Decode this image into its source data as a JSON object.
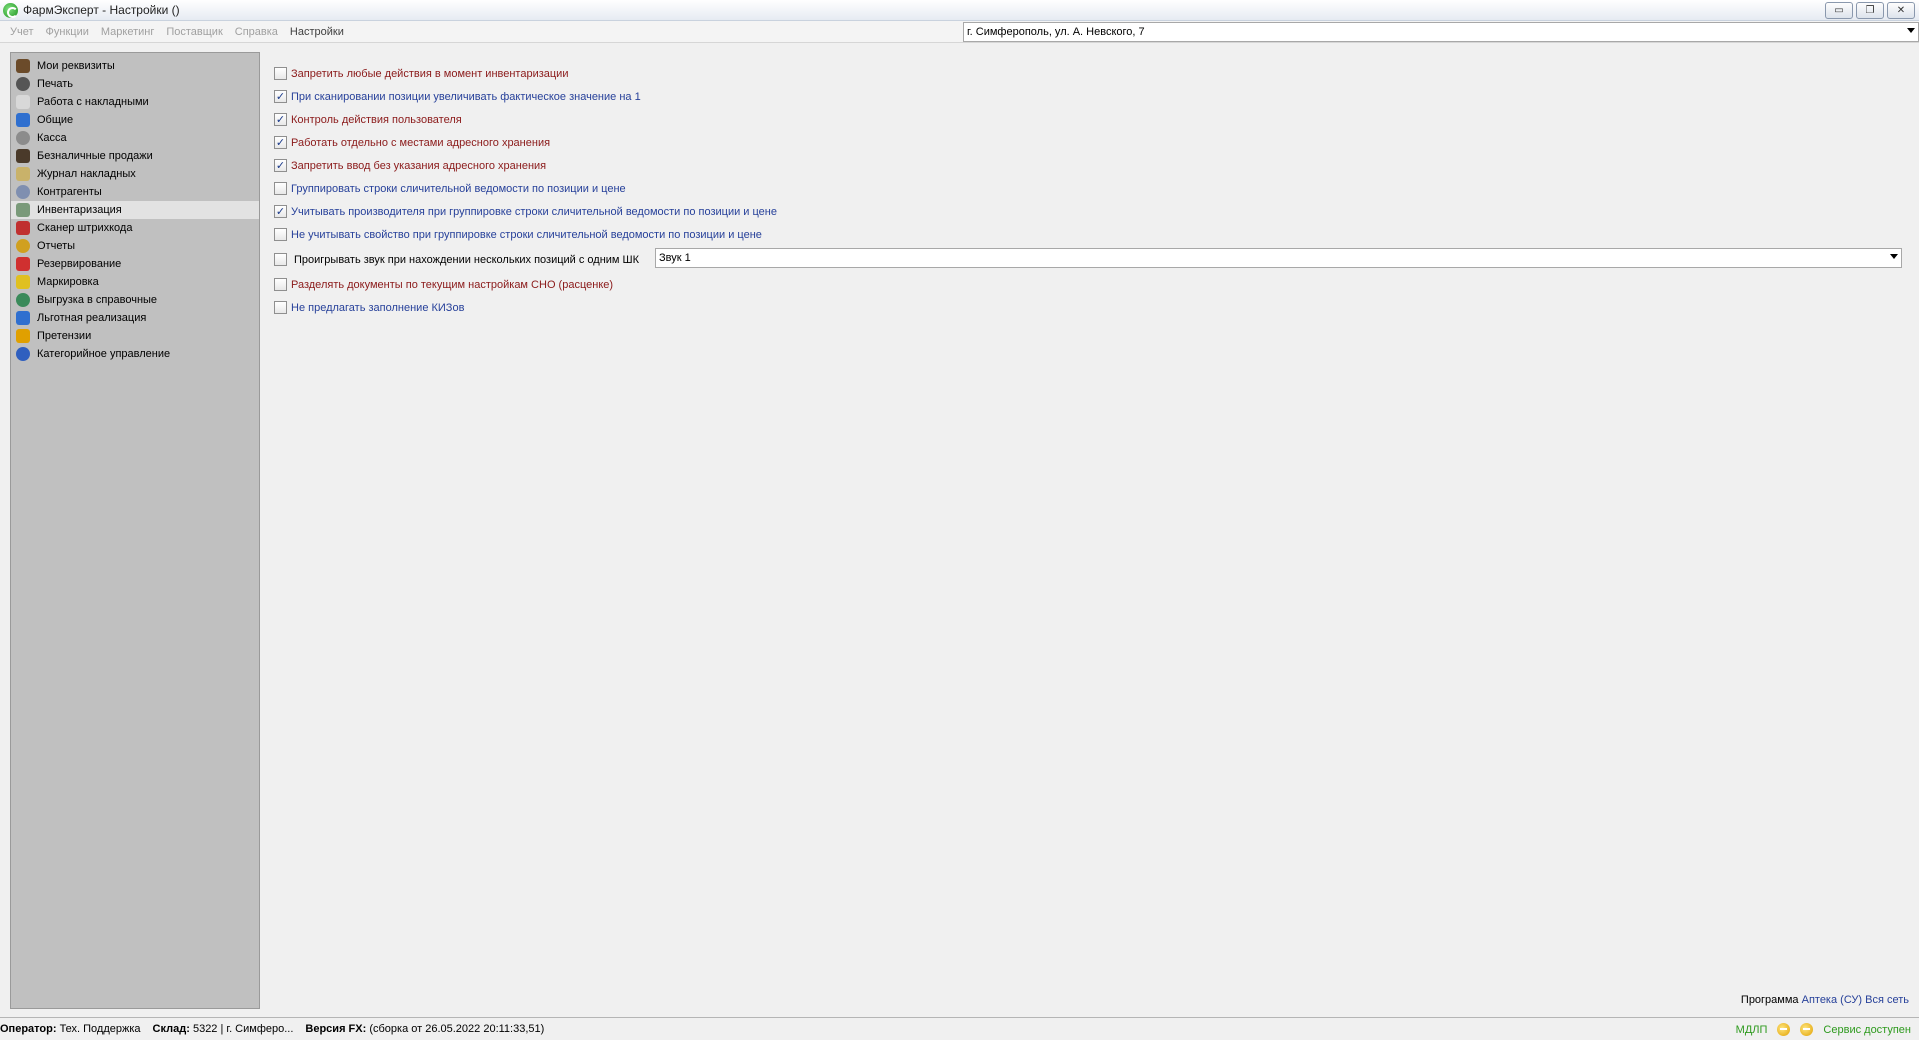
{
  "window": {
    "title": "ФармЭксперт - Настройки ()"
  },
  "window_controls": {
    "minimize": "▭",
    "restore": "❐",
    "close": "✕"
  },
  "menu": [
    {
      "label": "Учет",
      "active": false
    },
    {
      "label": "Функции",
      "active": false
    },
    {
      "label": "Маркетинг",
      "active": false
    },
    {
      "label": "Поставщик",
      "active": false
    },
    {
      "label": "Справка",
      "active": false
    },
    {
      "label": "Настройки",
      "active": true
    }
  ],
  "location": {
    "value": "г. Симферополь, ул. А. Невского, 7"
  },
  "sidebar": {
    "items": [
      {
        "label": "Мои реквизиты",
        "icon": "user-icon",
        "color": "#6b4b2a",
        "selected": false
      },
      {
        "label": "Печать",
        "icon": "printer-icon",
        "color": "#555555",
        "selected": false
      },
      {
        "label": "Работа с накладными",
        "icon": "document-icon",
        "color": "#d8d8d8",
        "selected": false
      },
      {
        "label": "Общие",
        "icon": "general-icon",
        "color": "#2f6fcf",
        "selected": false
      },
      {
        "label": "Касса",
        "icon": "cash-register-icon",
        "color": "#8c8c8c",
        "selected": false
      },
      {
        "label": "Безналичные продажи",
        "icon": "card-payment-icon",
        "color": "#4a3a2a",
        "selected": false
      },
      {
        "label": "Журнал накладных",
        "icon": "journal-icon",
        "color": "#c9b26a",
        "selected": false
      },
      {
        "label": "Контрагенты",
        "icon": "contractors-icon",
        "color": "#7f8fb0",
        "selected": false
      },
      {
        "label": "Инвентаризация",
        "icon": "inventory-icon",
        "color": "#7a9a7a",
        "selected": true
      },
      {
        "label": "Сканер штрихкода",
        "icon": "barcode-scanner-icon",
        "color": "#c03030",
        "selected": false
      },
      {
        "label": "Отчеты",
        "icon": "reports-icon",
        "color": "#d0a020",
        "selected": false
      },
      {
        "label": "Резервирование",
        "icon": "reservation-icon",
        "color": "#d03030",
        "selected": false
      },
      {
        "label": "Маркировка",
        "icon": "marking-icon",
        "color": "#e0c020",
        "selected": false
      },
      {
        "label": "Выгрузка в справочные",
        "icon": "globe-icon",
        "color": "#3a8a5a",
        "selected": false
      },
      {
        "label": "Льготная реализация",
        "icon": "discount-book-icon",
        "color": "#2f6fcf",
        "selected": false
      },
      {
        "label": "Претензии",
        "icon": "claims-icon",
        "color": "#e0a000",
        "selected": false
      },
      {
        "label": "Категорийное управление",
        "icon": "category-icon",
        "color": "#2f5fbf",
        "selected": false
      }
    ]
  },
  "settings": [
    {
      "label": "Запретить любые действия в момент инвентаризации",
      "checked": false,
      "color": "red"
    },
    {
      "label": "При сканировании позиции увеличивать фактическое значение на 1",
      "checked": true,
      "color": "blue"
    },
    {
      "label": "Контроль действия пользователя",
      "checked": true,
      "color": "red"
    },
    {
      "label": "Работать отдельно с местами адресного хранения",
      "checked": true,
      "color": "red"
    },
    {
      "label": "Запретить ввод без указания адресного хранения",
      "checked": true,
      "color": "red"
    },
    {
      "label": "Группировать строки сличительной ведомости по позиции и цене",
      "checked": false,
      "color": "blue"
    },
    {
      "label": "Учитывать производителя при группировке строки сличительной ведомости по позиции и цене",
      "checked": true,
      "color": "blue"
    },
    {
      "label": "Не учитывать свойство при группировке строки сличительной ведомости по позиции и цене",
      "checked": false,
      "color": "blue"
    }
  ],
  "sound_setting": {
    "label": "Проигрывать звук при нахождении нескольких позиций с одним ШК",
    "checked": false,
    "selected": "Звук 1"
  },
  "settings_bottom": [
    {
      "label": "Разделять документы по текущим настройкам СНО (расценке)",
      "checked": false,
      "color": "red"
    },
    {
      "label": "Не предлагать заполнение КИЗов",
      "checked": false,
      "color": "blue"
    }
  ],
  "program_info": {
    "prefix": "Программа",
    "app": "Аптека (СУ)",
    "scope": "Вся сеть"
  },
  "statusbar": {
    "operator_label": "Оператор:",
    "operator_value": "Тех. Поддержка",
    "warehouse_label": "Склад:",
    "warehouse_value": "5322 | г. Симферо...",
    "version_label": "Версия FX:",
    "version_value": "(сборка от 26.05.2022 20:11:33,51)",
    "mdlp": "МДЛП",
    "service": "Сервис доступен"
  },
  "colors": {
    "label_red": "#8b1a1a",
    "label_blue": "#27419a",
    "status_green": "#2e9a1e",
    "sidebar_bg": "#c0c0c0"
  }
}
